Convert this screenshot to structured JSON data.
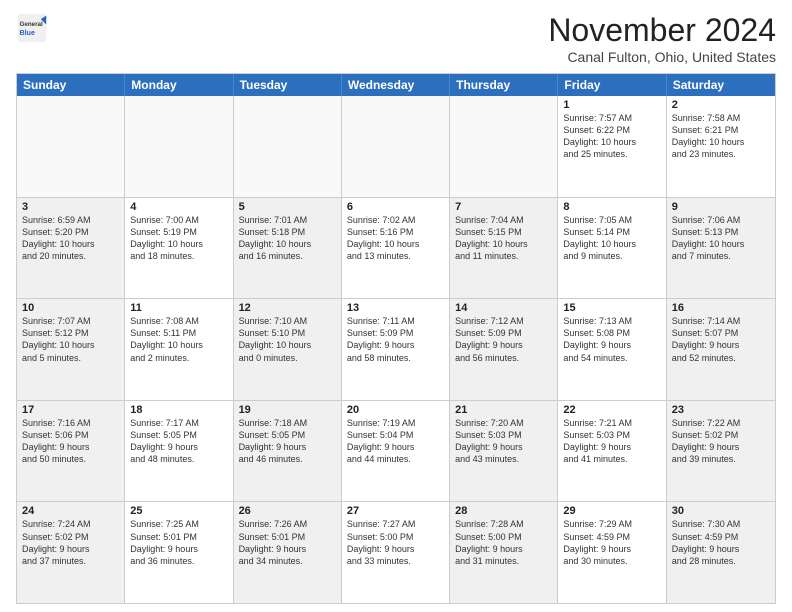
{
  "header": {
    "logo_general": "General",
    "logo_blue": "Blue",
    "month_title": "November 2024",
    "location": "Canal Fulton, Ohio, United States"
  },
  "calendar": {
    "days_of_week": [
      "Sunday",
      "Monday",
      "Tuesday",
      "Wednesday",
      "Thursday",
      "Friday",
      "Saturday"
    ],
    "rows": [
      [
        {
          "day": "",
          "empty": true
        },
        {
          "day": "",
          "empty": true
        },
        {
          "day": "",
          "empty": true
        },
        {
          "day": "",
          "empty": true
        },
        {
          "day": "",
          "empty": true
        },
        {
          "day": "1",
          "lines": [
            "Sunrise: 7:57 AM",
            "Sunset: 6:22 PM",
            "Daylight: 10 hours",
            "and 25 minutes."
          ]
        },
        {
          "day": "2",
          "lines": [
            "Sunrise: 7:58 AM",
            "Sunset: 6:21 PM",
            "Daylight: 10 hours",
            "and 23 minutes."
          ]
        }
      ],
      [
        {
          "day": "3",
          "shaded": true,
          "lines": [
            "Sunrise: 6:59 AM",
            "Sunset: 5:20 PM",
            "Daylight: 10 hours",
            "and 20 minutes."
          ]
        },
        {
          "day": "4",
          "lines": [
            "Sunrise: 7:00 AM",
            "Sunset: 5:19 PM",
            "Daylight: 10 hours",
            "and 18 minutes."
          ]
        },
        {
          "day": "5",
          "shaded": true,
          "lines": [
            "Sunrise: 7:01 AM",
            "Sunset: 5:18 PM",
            "Daylight: 10 hours",
            "and 16 minutes."
          ]
        },
        {
          "day": "6",
          "lines": [
            "Sunrise: 7:02 AM",
            "Sunset: 5:16 PM",
            "Daylight: 10 hours",
            "and 13 minutes."
          ]
        },
        {
          "day": "7",
          "shaded": true,
          "lines": [
            "Sunrise: 7:04 AM",
            "Sunset: 5:15 PM",
            "Daylight: 10 hours",
            "and 11 minutes."
          ]
        },
        {
          "day": "8",
          "lines": [
            "Sunrise: 7:05 AM",
            "Sunset: 5:14 PM",
            "Daylight: 10 hours",
            "and 9 minutes."
          ]
        },
        {
          "day": "9",
          "shaded": true,
          "lines": [
            "Sunrise: 7:06 AM",
            "Sunset: 5:13 PM",
            "Daylight: 10 hours",
            "and 7 minutes."
          ]
        }
      ],
      [
        {
          "day": "10",
          "shaded": true,
          "lines": [
            "Sunrise: 7:07 AM",
            "Sunset: 5:12 PM",
            "Daylight: 10 hours",
            "and 5 minutes."
          ]
        },
        {
          "day": "11",
          "lines": [
            "Sunrise: 7:08 AM",
            "Sunset: 5:11 PM",
            "Daylight: 10 hours",
            "and 2 minutes."
          ]
        },
        {
          "day": "12",
          "shaded": true,
          "lines": [
            "Sunrise: 7:10 AM",
            "Sunset: 5:10 PM",
            "Daylight: 10 hours",
            "and 0 minutes."
          ]
        },
        {
          "day": "13",
          "lines": [
            "Sunrise: 7:11 AM",
            "Sunset: 5:09 PM",
            "Daylight: 9 hours",
            "and 58 minutes."
          ]
        },
        {
          "day": "14",
          "shaded": true,
          "lines": [
            "Sunrise: 7:12 AM",
            "Sunset: 5:09 PM",
            "Daylight: 9 hours",
            "and 56 minutes."
          ]
        },
        {
          "day": "15",
          "lines": [
            "Sunrise: 7:13 AM",
            "Sunset: 5:08 PM",
            "Daylight: 9 hours",
            "and 54 minutes."
          ]
        },
        {
          "day": "16",
          "shaded": true,
          "lines": [
            "Sunrise: 7:14 AM",
            "Sunset: 5:07 PM",
            "Daylight: 9 hours",
            "and 52 minutes."
          ]
        }
      ],
      [
        {
          "day": "17",
          "shaded": true,
          "lines": [
            "Sunrise: 7:16 AM",
            "Sunset: 5:06 PM",
            "Daylight: 9 hours",
            "and 50 minutes."
          ]
        },
        {
          "day": "18",
          "lines": [
            "Sunrise: 7:17 AM",
            "Sunset: 5:05 PM",
            "Daylight: 9 hours",
            "and 48 minutes."
          ]
        },
        {
          "day": "19",
          "shaded": true,
          "lines": [
            "Sunrise: 7:18 AM",
            "Sunset: 5:05 PM",
            "Daylight: 9 hours",
            "and 46 minutes."
          ]
        },
        {
          "day": "20",
          "lines": [
            "Sunrise: 7:19 AM",
            "Sunset: 5:04 PM",
            "Daylight: 9 hours",
            "and 44 minutes."
          ]
        },
        {
          "day": "21",
          "shaded": true,
          "lines": [
            "Sunrise: 7:20 AM",
            "Sunset: 5:03 PM",
            "Daylight: 9 hours",
            "and 43 minutes."
          ]
        },
        {
          "day": "22",
          "lines": [
            "Sunrise: 7:21 AM",
            "Sunset: 5:03 PM",
            "Daylight: 9 hours",
            "and 41 minutes."
          ]
        },
        {
          "day": "23",
          "shaded": true,
          "lines": [
            "Sunrise: 7:22 AM",
            "Sunset: 5:02 PM",
            "Daylight: 9 hours",
            "and 39 minutes."
          ]
        }
      ],
      [
        {
          "day": "24",
          "shaded": true,
          "lines": [
            "Sunrise: 7:24 AM",
            "Sunset: 5:02 PM",
            "Daylight: 9 hours",
            "and 37 minutes."
          ]
        },
        {
          "day": "25",
          "lines": [
            "Sunrise: 7:25 AM",
            "Sunset: 5:01 PM",
            "Daylight: 9 hours",
            "and 36 minutes."
          ]
        },
        {
          "day": "26",
          "shaded": true,
          "lines": [
            "Sunrise: 7:26 AM",
            "Sunset: 5:01 PM",
            "Daylight: 9 hours",
            "and 34 minutes."
          ]
        },
        {
          "day": "27",
          "lines": [
            "Sunrise: 7:27 AM",
            "Sunset: 5:00 PM",
            "Daylight: 9 hours",
            "and 33 minutes."
          ]
        },
        {
          "day": "28",
          "shaded": true,
          "lines": [
            "Sunrise: 7:28 AM",
            "Sunset: 5:00 PM",
            "Daylight: 9 hours",
            "and 31 minutes."
          ]
        },
        {
          "day": "29",
          "lines": [
            "Sunrise: 7:29 AM",
            "Sunset: 4:59 PM",
            "Daylight: 9 hours",
            "and 30 minutes."
          ]
        },
        {
          "day": "30",
          "shaded": true,
          "lines": [
            "Sunrise: 7:30 AM",
            "Sunset: 4:59 PM",
            "Daylight: 9 hours",
            "and 28 minutes."
          ]
        }
      ]
    ]
  }
}
